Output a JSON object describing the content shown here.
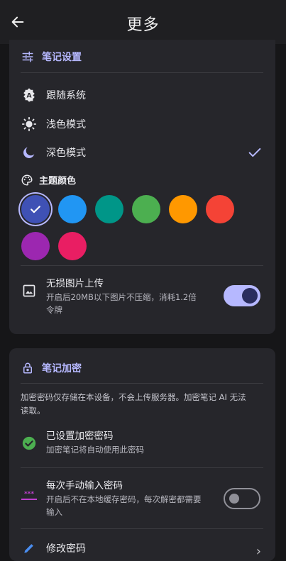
{
  "header": {
    "title": "更多",
    "back_icon": "arrow-left-icon"
  },
  "note_settings": {
    "title": "笔记设置",
    "theme_modes": [
      {
        "label": "跟随系统",
        "icon": "auto-mode-icon",
        "selected": false
      },
      {
        "label": "浅色模式",
        "icon": "sun-icon",
        "selected": false
      },
      {
        "label": "深色模式",
        "icon": "moon-icon",
        "selected": true
      }
    ],
    "theme_color_title": "主题颜色",
    "colors": [
      "#3f51b5",
      "#2196f3",
      "#009688",
      "#4caf50",
      "#ff9800",
      "#f44336",
      "#9c27b0",
      "#e91e63"
    ],
    "selected_color_index": 0,
    "lossless": {
      "title": "无损图片上传",
      "desc_line1": "开启后20MB以下图片不压缩，消耗1.2倍",
      "desc_line2": "令牌",
      "enabled": true
    }
  },
  "encryption": {
    "title": "笔记加密",
    "desc_line1": "加密密码仅存储在本设备，不会上传服务器。加密笔记 AI 无法",
    "desc_line2": "读取。",
    "password_set": {
      "title": "已设置加密密码",
      "desc": "加密笔记将自动使用此密码"
    },
    "manual_input": {
      "title": "每次手动输入密码",
      "desc_line1": "开启后不在本地缓存密码，每次解密都需要",
      "desc_line2": "输入",
      "enabled": false
    },
    "change_password": {
      "title": "修改密码"
    }
  },
  "colors": {
    "accent": "#b6b8ff",
    "card": "#26262b",
    "background": "#161618",
    "success": "#4caf50"
  }
}
